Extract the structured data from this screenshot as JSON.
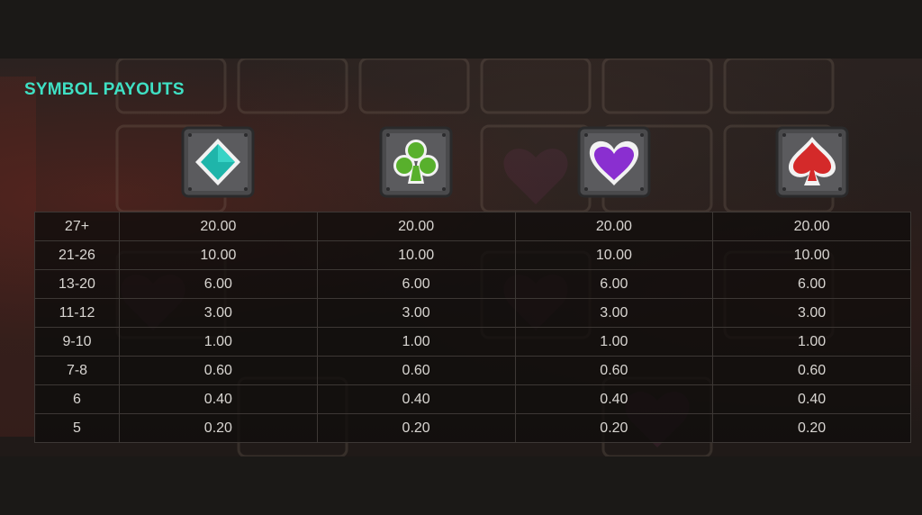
{
  "title": "SYMBOL PAYOUTS",
  "symbols": [
    {
      "icon": "diamond-suit-icon",
      "color": "#1fb5aa"
    },
    {
      "icon": "club-suit-icon",
      "color": "#58b02c"
    },
    {
      "icon": "heart-suit-icon",
      "color": "#8a2fd0"
    },
    {
      "icon": "spade-suit-icon",
      "color": "#d42a2a"
    }
  ],
  "rows": [
    {
      "count": "27+",
      "payouts": [
        "20.00",
        "20.00",
        "20.00",
        "20.00"
      ]
    },
    {
      "count": "21-26",
      "payouts": [
        "10.00",
        "10.00",
        "10.00",
        "10.00"
      ]
    },
    {
      "count": "13-20",
      "payouts": [
        "6.00",
        "6.00",
        "6.00",
        "6.00"
      ]
    },
    {
      "count": "11-12",
      "payouts": [
        "3.00",
        "3.00",
        "3.00",
        "3.00"
      ]
    },
    {
      "count": "9-10",
      "payouts": [
        "1.00",
        "1.00",
        "1.00",
        "1.00"
      ]
    },
    {
      "count": "7-8",
      "payouts": [
        "0.60",
        "0.60",
        "0.60",
        "0.60"
      ]
    },
    {
      "count": "6",
      "payouts": [
        "0.40",
        "0.40",
        "0.40",
        "0.40"
      ]
    },
    {
      "count": "5",
      "payouts": [
        "0.20",
        "0.20",
        "0.20",
        "0.20"
      ]
    }
  ]
}
